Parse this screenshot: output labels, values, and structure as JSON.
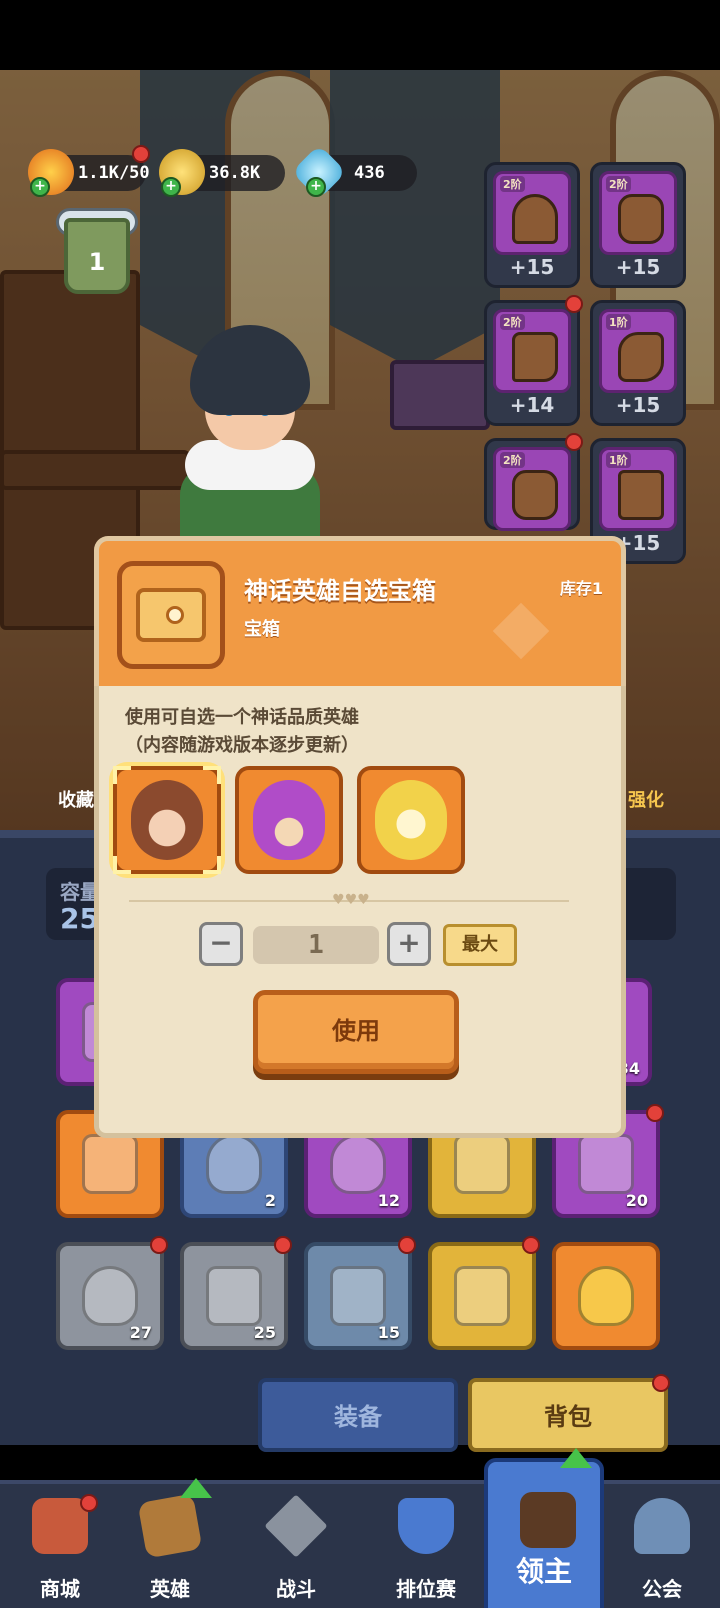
{
  "resources": {
    "stamina": "1.1K/50",
    "gold": "36.8K",
    "gems": "436"
  },
  "player": {
    "rank_level": "1"
  },
  "equipment": [
    {
      "tier": "2阶",
      "level": "+15",
      "color": "#9a46b5"
    },
    {
      "tier": "2阶",
      "level": "+15",
      "color": "#9a46b5"
    },
    {
      "tier": "2阶",
      "level": "+14",
      "color": "#9a46b5"
    },
    {
      "tier": "1阶",
      "level": "+15",
      "color": "#9a46b5"
    },
    {
      "tier": "2阶",
      "level": "",
      "color": "#9a46b5"
    },
    {
      "tier": "1阶",
      "level": "+15",
      "color": "#9a46b5"
    }
  ],
  "side_buttons": {
    "collect": "收藏",
    "enhance": "强化"
  },
  "capacity": {
    "label": "容量",
    "value": "25"
  },
  "bag_slots_row1": [
    {
      "color": "purple",
      "count": ""
    },
    {
      "color": "purple",
      "count": "34"
    }
  ],
  "bag_slots_row2": [
    {
      "color": "orange",
      "count": ""
    },
    {
      "color": "blue",
      "count": "2"
    },
    {
      "color": "purple",
      "count": "12"
    },
    {
      "color": "gold",
      "count": ""
    },
    {
      "color": "purple",
      "count": "20"
    }
  ],
  "bag_slots_row3": [
    {
      "color": "gray",
      "count": "27"
    },
    {
      "color": "gray",
      "count": "25"
    },
    {
      "color": "teal",
      "count": "15"
    },
    {
      "color": "gold",
      "count": ""
    },
    {
      "color": "orange",
      "count": ""
    }
  ],
  "tabs": {
    "equip": "装备",
    "bag": "背包"
  },
  "nav": [
    {
      "label": "商城",
      "icon": "shop-icon"
    },
    {
      "label": "英雄",
      "icon": "hero-card-icon"
    },
    {
      "label": "战斗",
      "icon": "crossed-swords-icon"
    },
    {
      "label": "排位赛",
      "icon": "ranking-shield-icon"
    },
    {
      "label": "领主",
      "icon": "lord-banner-icon"
    },
    {
      "label": "公会",
      "icon": "guild-castle-icon"
    }
  ],
  "modal": {
    "title": "神话英雄自选宝箱",
    "subtitle": "宝箱",
    "stock": "库存1",
    "desc_line1": "使用可自选一个神话品质英雄",
    "desc_line2": "（内容随游戏版本逐步更新）",
    "quantity": "1",
    "max_label": "最大",
    "minus_label": "−",
    "plus_label": "+",
    "use_label": "使用",
    "hero_options": [
      {
        "name": "brown-haired-girl-hero",
        "color": "#8b4a2e"
      },
      {
        "name": "purple-flame-spirit-hero",
        "color": "#b04cc8"
      },
      {
        "name": "yellow-lightning-cat-hero",
        "color": "#f2d24a"
      }
    ]
  }
}
